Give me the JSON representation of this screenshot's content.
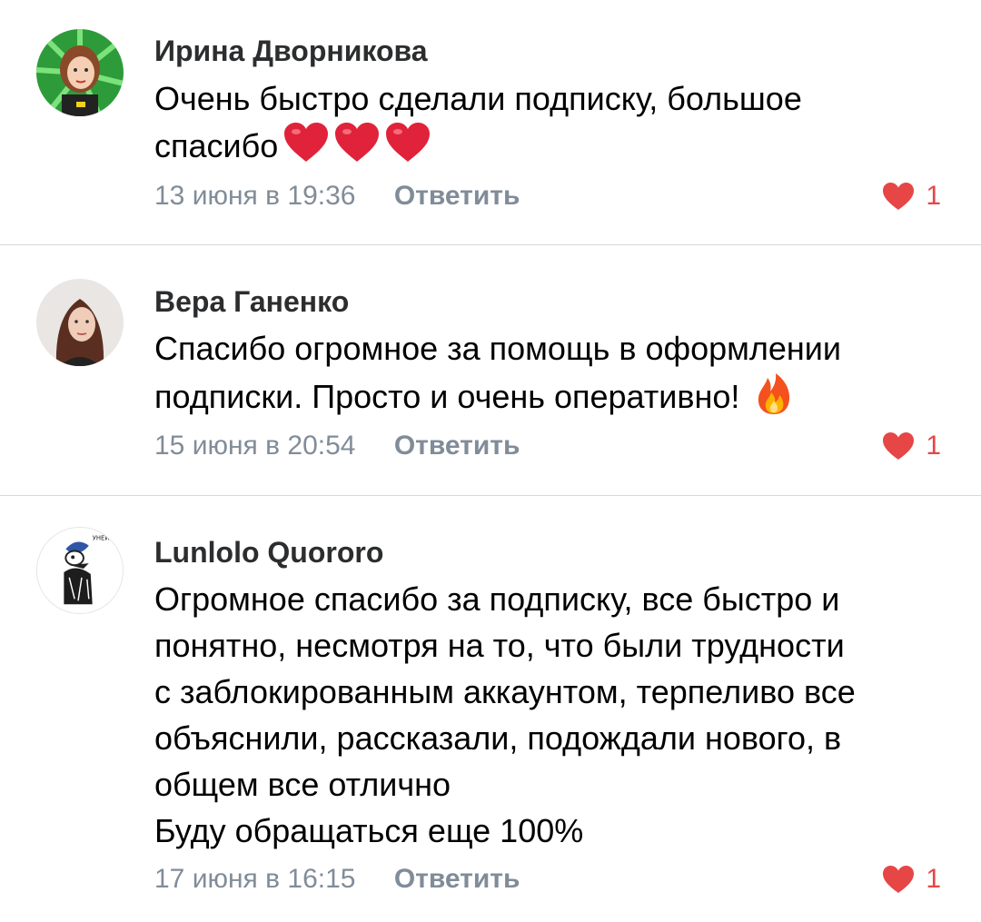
{
  "comments": [
    {
      "author": "Ирина Дворникова",
      "text_lines": [
        "Очень быстро сделали подписку, большое",
        "спасибо"
      ],
      "emojis": [
        "heart",
        "heart",
        "heart"
      ],
      "date": "13 июня в 19:36",
      "reply_label": "Ответить",
      "likes": "1"
    },
    {
      "author": "Вера Ганенко",
      "text_lines": [
        "Спасибо огромное за помощь в оформлении",
        "подписки. Просто и очень оперативно!"
      ],
      "emojis": [
        "fire"
      ],
      "date": "15 июня в 20:54",
      "reply_label": "Ответить",
      "likes": "1"
    },
    {
      "author": "Lunlolo Quororo",
      "text_lines": [
        "Огромное спасибо за подписку, все быстро и",
        "понятно, несмотря на то, что были трудности",
        "с заблокированным аккаунтом, терпеливо все",
        "объяснили, рассказали, подождали нового, в",
        "общем все отлично",
        "Буду обращаться еще 100%"
      ],
      "date": "17 июня в 16:15",
      "reply_label": "Ответить",
      "likes": "1"
    }
  ],
  "colors": {
    "like": "#e64646",
    "meta": "#818c99",
    "divider": "#d7d8d9"
  }
}
